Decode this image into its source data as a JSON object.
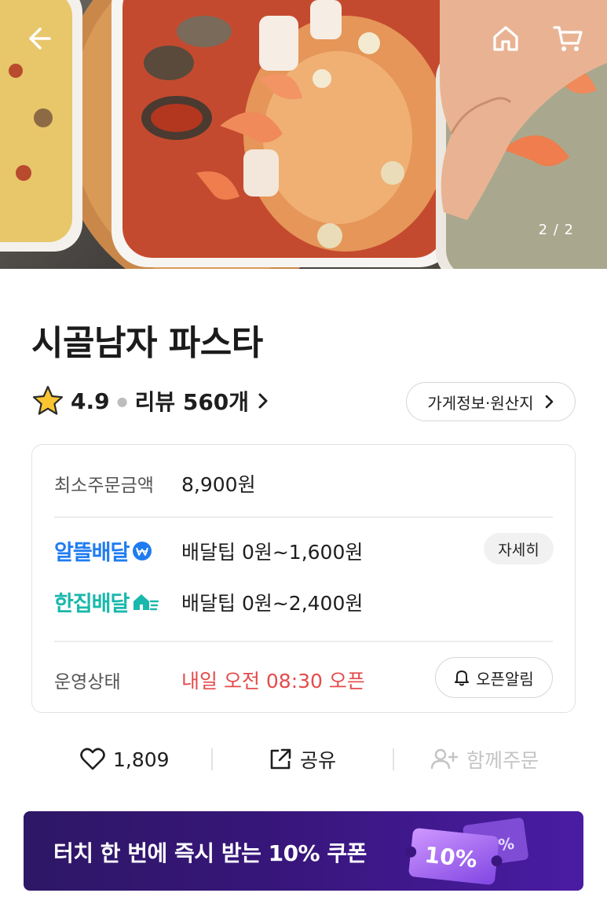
{
  "hero": {
    "image_counter": "2 / 2"
  },
  "store": {
    "name": "시골남자 파스타",
    "rating": "4.9",
    "review_label": "리뷰 560개",
    "info_chip_label": "가게정보·원산지"
  },
  "info_card": {
    "min_order_label": "최소주문금액",
    "min_order_value": "8,900원",
    "delivery_options": [
      {
        "brand": "알뜰배달",
        "tip": "배달팁 0원~1,600원",
        "color": "#1f7cf0"
      },
      {
        "brand": "한집배달",
        "tip": "배달팁 0원~2,400원",
        "color": "#19b8ac"
      }
    ],
    "detail_button_label": "자세히",
    "status_label": "운영상태",
    "status_value": "내일 오전 08:30 오픈",
    "status_color": "#e54b4b",
    "alarm_button_label": "오픈알림"
  },
  "actions": {
    "like_count": "1,809",
    "share_label": "공유",
    "group_order_label": "함께주문"
  },
  "coupon_banner": {
    "text": "터치 한 번에 즉시 받는 10% 쿠폰",
    "badge": "10%"
  },
  "icons": [
    "back-arrow-icon",
    "home-icon",
    "cart-icon",
    "star-icon",
    "chevron-right-icon",
    "bell-icon",
    "heart-icon",
    "share-icon",
    "add-person-icon",
    "coupon-ticket-icon"
  ]
}
